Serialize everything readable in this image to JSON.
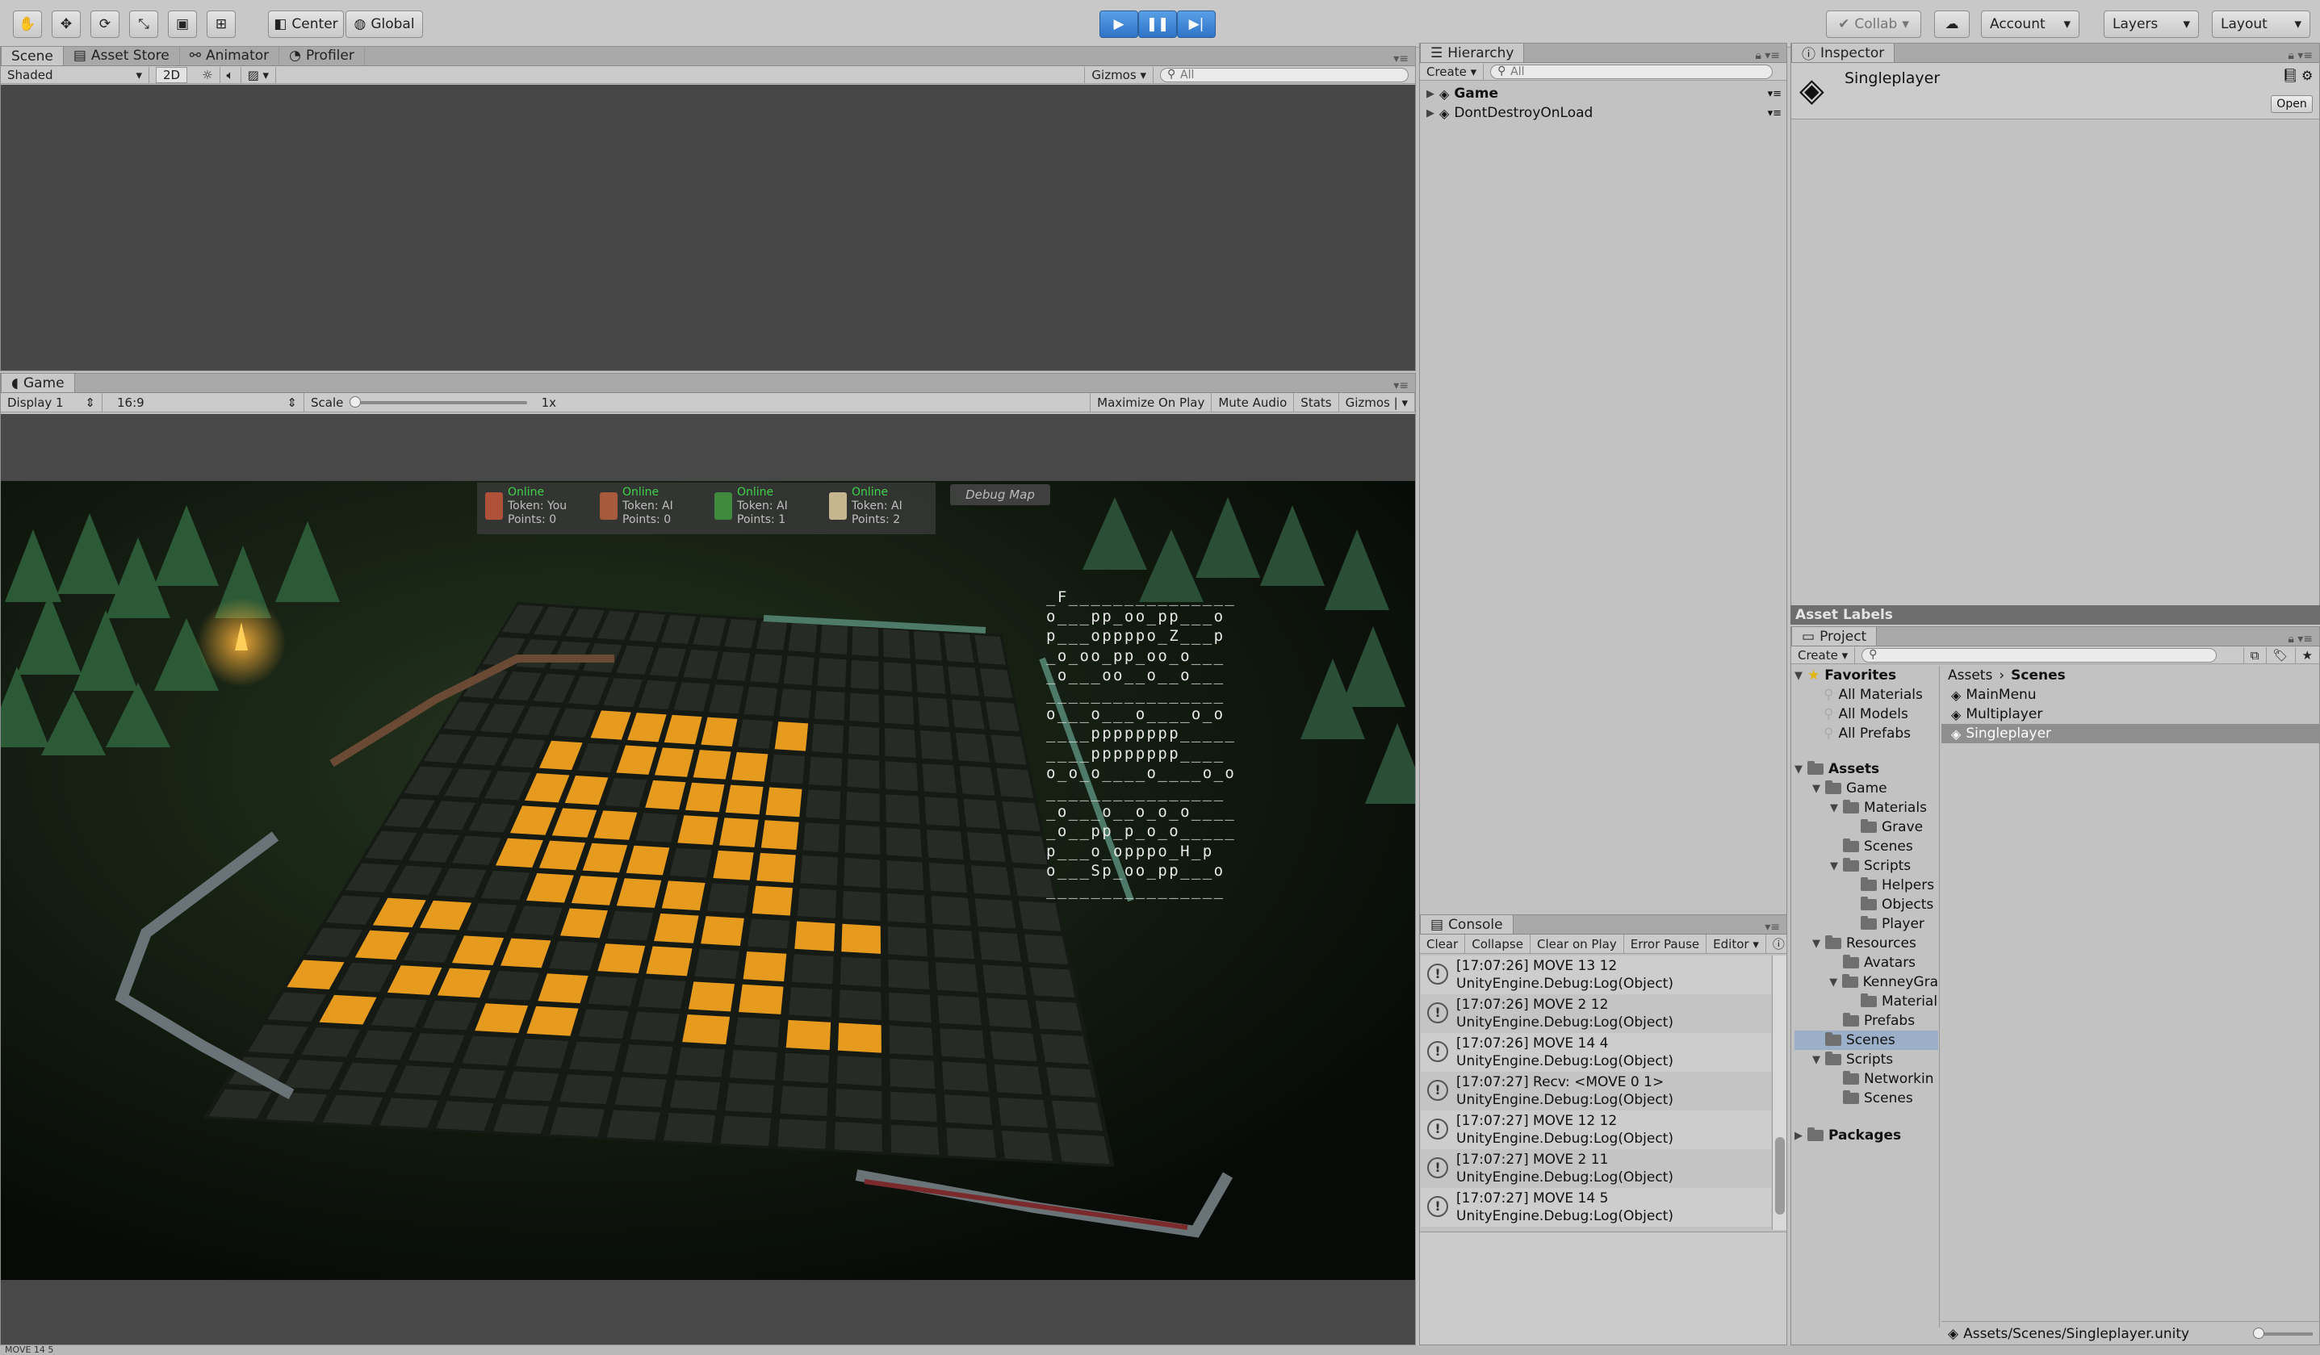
{
  "toolbar": {
    "pivot_label": "Center",
    "space_label": "Global",
    "collab_label": "Collab",
    "account_label": "Account",
    "layers_label": "Layers",
    "layout_label": "Layout",
    "tools": [
      "hand-tool-icon",
      "move-tool-icon",
      "rotate-tool-icon",
      "scale-tool-icon",
      "rect-tool-icon",
      "transform-tool-icon"
    ]
  },
  "scene_panel": {
    "tabs": [
      "Scene",
      "Asset Store",
      "Animator",
      "Profiler"
    ],
    "shading_mode": "Shaded",
    "mode_2d": "2D",
    "gizmos_label": "Gizmos",
    "search_placeholder": "All"
  },
  "game_panel": {
    "tab": "Game",
    "display": "Display 1",
    "aspect": "16:9",
    "scale_label": "Scale",
    "scale_value": "1x",
    "scale_fraction": 0.0,
    "maximize_label": "Maximize On Play",
    "mute_label": "Mute Audio",
    "stats_label": "Stats",
    "gizmos_label": "Gizmos",
    "hud": {
      "players": [
        {
          "status": "Online",
          "token": "Token: You",
          "points": "Points: 0",
          "color": "#b0513a"
        },
        {
          "status": "Online",
          "token": "Token: AI",
          "points": "Points: 0",
          "color": "#a85a3c"
        },
        {
          "status": "Online",
          "token": "Token: AI",
          "points": "Points: 1",
          "color": "#3f8a3c"
        },
        {
          "status": "Online",
          "token": "Token: AI",
          "points": "Points: 2",
          "color": "#c7b58f"
        }
      ],
      "debug_map_button": "Debug Map"
    },
    "debug_map_lines": [
      "_F_______________",
      "o___pp_oo_pp___o",
      "p___oppppo_Z___p",
      "_o_oo_pp_oo_o___",
      "_o___oo__o__o___",
      "________________",
      "o___o___o____o_o",
      "____pppppppp_____",
      "____pppppppp____",
      "o_o_o____o____o_o",
      "________________",
      "_o___o__o_o_o____",
      "_o__pp_p_o_o_____",
      "p___o_opppo_H_p",
      "o___Sp_oo_pp___o",
      "________________"
    ]
  },
  "hierarchy": {
    "tab": "Hierarchy",
    "create_label": "Create",
    "search_placeholder": "All",
    "items": [
      "Game",
      "DontDestroyOnLoad"
    ]
  },
  "console": {
    "tab": "Console",
    "buttons": [
      "Clear",
      "Collapse",
      "Clear on Play",
      "Error Pause",
      "Editor"
    ],
    "entries": [
      {
        "line1": "[17:07:26] MOVE 13 12",
        "line2": "UnityEngine.Debug:Log(Object)"
      },
      {
        "line1": "[17:07:26] MOVE 2 12",
        "line2": "UnityEngine.Debug:Log(Object)"
      },
      {
        "line1": "[17:07:26] MOVE 14 4",
        "line2": "UnityEngine.Debug:Log(Object)"
      },
      {
        "line1": "[17:07:27] Recv: <MOVE 0 1>",
        "line2": "UnityEngine.Debug:Log(Object)"
      },
      {
        "line1": "[17:07:27] MOVE 12 12",
        "line2": "UnityEngine.Debug:Log(Object)"
      },
      {
        "line1": "[17:07:27] MOVE 2 11",
        "line2": "UnityEngine.Debug:Log(Object)"
      },
      {
        "line1": "[17:07:27] MOVE 14 5",
        "line2": "UnityEngine.Debug:Log(Object)"
      }
    ]
  },
  "inspector": {
    "tab": "Inspector",
    "title": "Singleplayer",
    "open_label": "Open",
    "asset_labels": "Asset Labels"
  },
  "project": {
    "tab": "Project",
    "create_label": "Create",
    "favorites_label": "Favorites",
    "favorites": [
      "All Materials",
      "All Models",
      "All Prefabs"
    ],
    "tree": [
      {
        "label": "Assets",
        "level": 0,
        "bold": true,
        "arrow": "▼"
      },
      {
        "label": "Game",
        "level": 1,
        "arrow": "▼"
      },
      {
        "label": "Materials",
        "level": 2,
        "arrow": "▼"
      },
      {
        "label": "Grave",
        "level": 3,
        "arrow": ""
      },
      {
        "label": "Scenes",
        "level": 2,
        "arrow": ""
      },
      {
        "label": "Scripts",
        "level": 2,
        "arrow": "▼"
      },
      {
        "label": "Helpers",
        "level": 3,
        "arrow": ""
      },
      {
        "label": "Objects",
        "level": 3,
        "arrow": ""
      },
      {
        "label": "Player",
        "level": 3,
        "arrow": ""
      },
      {
        "label": "Resources",
        "level": 1,
        "arrow": "▼"
      },
      {
        "label": "Avatars",
        "level": 2,
        "arrow": ""
      },
      {
        "label": "KenneyGra",
        "level": 2,
        "arrow": "▼"
      },
      {
        "label": "Material",
        "level": 3,
        "arrow": ""
      },
      {
        "label": "Prefabs",
        "level": 2,
        "arrow": ""
      },
      {
        "label": "Scenes",
        "level": 1,
        "arrow": "",
        "selected": true
      },
      {
        "label": "Scripts",
        "level": 1,
        "arrow": "▼"
      },
      {
        "label": "Networkin",
        "level": 2,
        "arrow": ""
      },
      {
        "label": "Scenes",
        "level": 2,
        "arrow": ""
      }
    ],
    "packages_label": "Packages",
    "breadcrumb": [
      "Assets",
      "Scenes"
    ],
    "files": [
      "MainMenu",
      "Multiplayer",
      "Singleplayer"
    ],
    "selected_file": "Singleplayer",
    "footer_path": "Assets/Scenes/Singleplayer.unity"
  },
  "status_bar": "MOVE 14 5"
}
